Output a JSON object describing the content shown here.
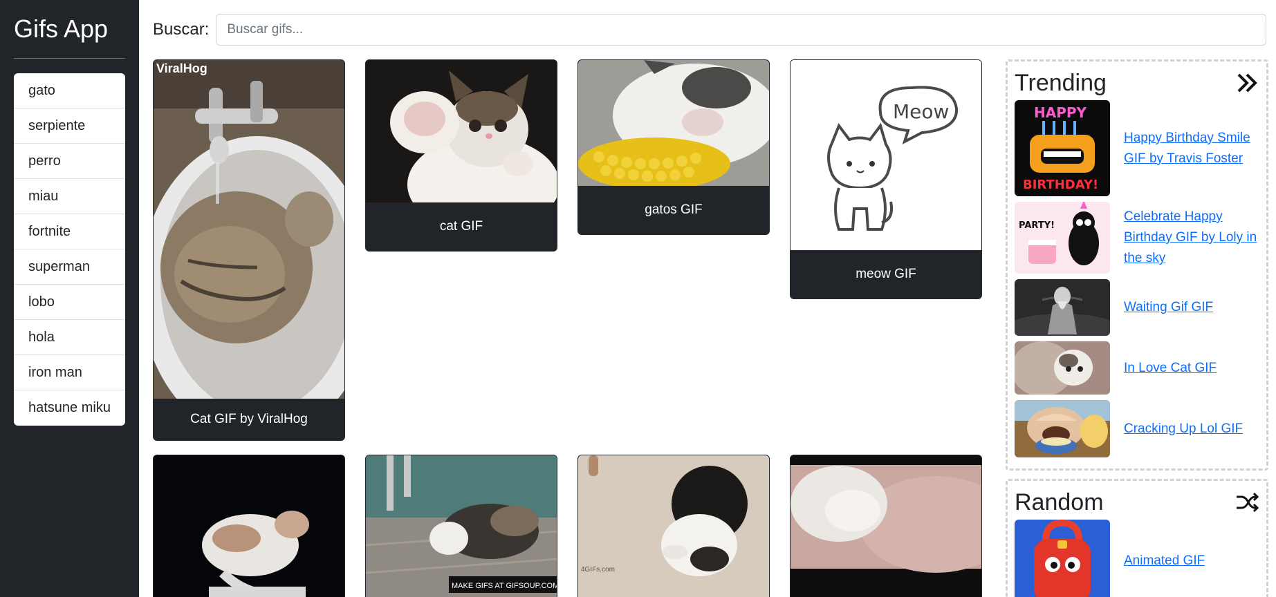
{
  "app": {
    "title": "Gifs App"
  },
  "history": [
    "gato",
    "serpiente",
    "perro",
    "miau",
    "fortnite",
    "superman",
    "lobo",
    "hola",
    "iron man",
    "hatsune miku"
  ],
  "search": {
    "label": "Buscar:",
    "placeholder": "Buscar gifs..."
  },
  "gifs": [
    {
      "caption": "Cat GIF by ViralHog",
      "watermark": "ViralHog"
    },
    {
      "caption": "cat GIF",
      "watermark": ""
    },
    {
      "caption": "gatos GIF",
      "watermark": ""
    },
    {
      "caption": "meow GIF",
      "bubble": "Meow"
    },
    {
      "caption": "",
      "watermark": ""
    },
    {
      "caption": "",
      "watermark": "MAKE GIFS AT GIFSOUP.COM"
    },
    {
      "caption": "",
      "watermark": "4GIFs.com"
    },
    {
      "caption": "",
      "watermark": ""
    }
  ],
  "trending": {
    "title": "Trending",
    "icon": "double-chevron-right-icon",
    "items": [
      {
        "label": "Happy Birthday Smile GIF by Travis Foster",
        "thumb_text_top": "HAPPY",
        "thumb_text_bottom": "BIRTHDAY!"
      },
      {
        "label": "Celebrate Happy Birthday GIF by Loly in the sky",
        "thumb_text_top": "PARTY!"
      },
      {
        "label": "Waiting Gif GIF"
      },
      {
        "label": "In Love Cat GIF"
      },
      {
        "label": "Cracking Up Lol GIF"
      }
    ]
  },
  "random": {
    "title": "Random",
    "icon": "shuffle-icon",
    "items": [
      {
        "label": "Animated GIF"
      }
    ]
  }
}
